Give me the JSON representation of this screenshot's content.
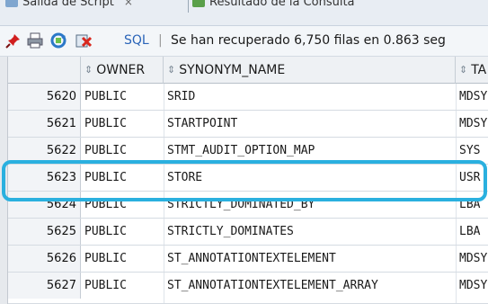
{
  "tabs": [
    {
      "label": "Salida de Script",
      "close": "×"
    },
    {
      "label": "Resultado de la Consulta"
    }
  ],
  "toolbar": {
    "icons": [
      "pin-icon",
      "print-icon",
      "refresh-icon",
      "export-icon"
    ],
    "sql_label": "SQL",
    "separator": "|",
    "status": "Se han recuperado 6,750 filas en 0.863 seg"
  },
  "grid": {
    "columns": [
      "OWNER",
      "SYNONYM_NAME",
      "TA"
    ],
    "rows": [
      {
        "num": "5620",
        "owner": "PUBLIC",
        "synonym": "SRID",
        "table": "MDSY"
      },
      {
        "num": "5621",
        "owner": "PUBLIC",
        "synonym": "STARTPOINT",
        "table": "MDSY"
      },
      {
        "num": "5622",
        "owner": "PUBLIC",
        "synonym": "STMT_AUDIT_OPTION_MAP",
        "table": "SYS"
      },
      {
        "num": "5623",
        "owner": "PUBLIC",
        "synonym": "STORE",
        "table": "USR"
      },
      {
        "num": "5624",
        "owner": "PUBLIC",
        "synonym": "STRICTLY_DOMINATED_BY",
        "table": "LBA"
      },
      {
        "num": "5625",
        "owner": "PUBLIC",
        "synonym": "STRICTLY_DOMINATES",
        "table": "LBA"
      },
      {
        "num": "5626",
        "owner": "PUBLIC",
        "synonym": "ST_ANNOTATIONTEXTELEMENT",
        "table": "MDSY"
      },
      {
        "num": "5627",
        "owner": "PUBLIC",
        "synonym": "ST_ANNOTATIONTEXTELEMENT_ARRAY",
        "table": "MDSY"
      }
    ],
    "highlighted_row": "5623",
    "highlight_color": "#2ab0df"
  }
}
